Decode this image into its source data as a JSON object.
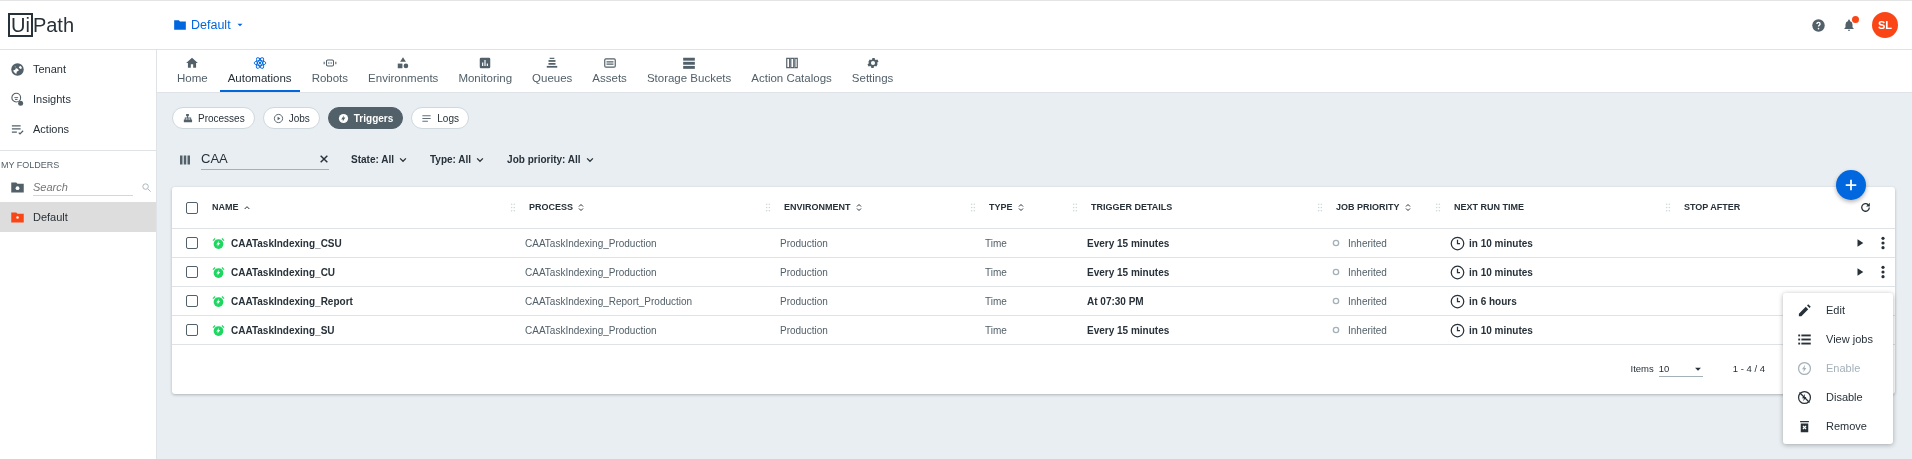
{
  "header": {
    "logo": {
      "boxed": "Ui",
      "rest": "Path"
    },
    "folder": "Default",
    "avatar": "SL",
    "notification": true
  },
  "sidebar": {
    "items": [
      {
        "label": "Tenant"
      },
      {
        "label": "Insights"
      },
      {
        "label": "Actions"
      }
    ],
    "section": "MY FOLDERS",
    "search": {
      "placeholder": "Search"
    },
    "folders": [
      {
        "label": "Default",
        "selected": true
      }
    ]
  },
  "tabs": [
    {
      "label": "Home",
      "selected": false
    },
    {
      "label": "Automations",
      "selected": true
    },
    {
      "label": "Robots",
      "selected": false
    },
    {
      "label": "Environments",
      "selected": false
    },
    {
      "label": "Monitoring",
      "selected": false
    },
    {
      "label": "Queues",
      "selected": false
    },
    {
      "label": "Assets",
      "selected": false
    },
    {
      "label": "Storage Buckets",
      "selected": false
    },
    {
      "label": "Action Catalogs",
      "selected": false
    },
    {
      "label": "Settings",
      "selected": false
    }
  ],
  "subtabs": [
    {
      "label": "Processes",
      "selected": false
    },
    {
      "label": "Jobs",
      "selected": false
    },
    {
      "label": "Triggers",
      "selected": true
    },
    {
      "label": "Logs",
      "selected": false
    }
  ],
  "filters": {
    "search": {
      "value": "CAA"
    },
    "dropdowns": [
      "State: All",
      "Type: All",
      "Job priority: All"
    ]
  },
  "table": {
    "select_all_checked": false,
    "columns": [
      {
        "label": "NAME",
        "sorted": true
      },
      {
        "label": "PROCESS",
        "sorted": false
      },
      {
        "label": "ENVIRONMENT",
        "sorted": false
      },
      {
        "label": "TYPE",
        "sorted": false
      },
      {
        "label": "TRIGGER DETAILS"
      },
      {
        "label": "JOB PRIORITY",
        "sorted": false
      },
      {
        "label": "NEXT RUN TIME"
      },
      {
        "label": "STOP AFTER"
      }
    ],
    "rows": [
      {
        "checked": false,
        "name": "CAATaskIndexing_CSU",
        "process": "CAATaskIndexing_Production",
        "environment": "Production",
        "type": "Time",
        "trigger_details": "Every 15 minutes",
        "job_priority": "Inherited",
        "next_run_time": "in 10 minutes",
        "actions_shown": true
      },
      {
        "checked": false,
        "name": "CAATaskIndexing_CU",
        "process": "CAATaskIndexing_Production",
        "environment": "Production",
        "type": "Time",
        "trigger_details": "Every 15 minutes",
        "job_priority": "Inherited",
        "next_run_time": "in 10 minutes",
        "actions_shown": true
      },
      {
        "checked": false,
        "name": "CAATaskIndexing_Report",
        "process": "CAATaskIndexing_Report_Production",
        "environment": "Production",
        "type": "Time",
        "trigger_details": "At 07:30 PM",
        "job_priority": "Inherited",
        "next_run_time": "in 6 hours"
      },
      {
        "checked": false,
        "name": "CAATaskIndexing_SU",
        "process": "CAATaskIndexing_Production",
        "environment": "Production",
        "type": "Time",
        "trigger_details": "Every 15 minutes",
        "job_priority": "Inherited",
        "next_run_time": "in 10 minutes"
      }
    ],
    "pagination": {
      "items_label": "Items",
      "page_size": "10",
      "range": "1 - 4 / 4"
    }
  },
  "menu": [
    {
      "label": "Edit",
      "disabled": false
    },
    {
      "label": "View jobs",
      "disabled": false
    },
    {
      "label": "Enable",
      "disabled": true
    },
    {
      "label": "Disable",
      "disabled": false
    },
    {
      "label": "Remove",
      "disabled": false
    }
  ]
}
